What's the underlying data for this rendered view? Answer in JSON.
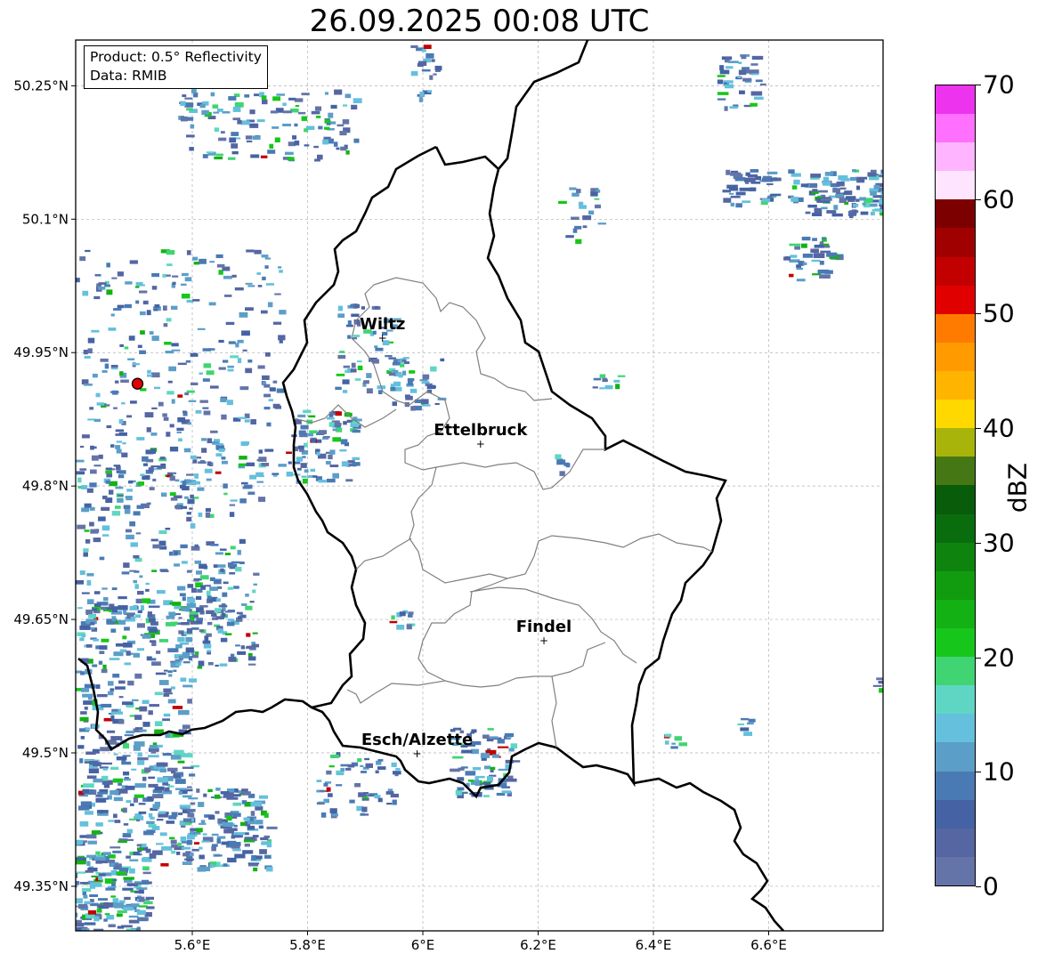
{
  "title": "26.09.2025 00:08 UTC",
  "infobox": {
    "product": "Product: 0.5° Reflectivity",
    "data": "Data: RMIB"
  },
  "lon_ticks": [
    "5.6°E",
    "5.8°E",
    "6°E",
    "6.2°E",
    "6.4°E",
    "6.6°E"
  ],
  "lat_ticks": [
    "50.25°N",
    "50.1°N",
    "49.95°N",
    "49.8°N",
    "49.65°N",
    "49.5°N",
    "49.35°N"
  ],
  "cities": [
    {
      "name": "Wiltz",
      "lon": 5.93,
      "lat": 49.967
    },
    {
      "name": "Ettelbruck",
      "lon": 6.1,
      "lat": 49.848
    },
    {
      "name": "Findel",
      "lon": 6.21,
      "lat": 49.627
    },
    {
      "name": "Esch/Alzette",
      "lon": 5.99,
      "lat": 49.5
    }
  ],
  "radar_site": {
    "lon": 5.505,
    "lat": 49.915,
    "color": "#e00000"
  },
  "colorbar": {
    "label": "dBZ",
    "ticks": [
      "0",
      "10",
      "20",
      "30",
      "40",
      "50",
      "60",
      "70"
    ],
    "colors": [
      "#6474a8",
      "#5566a2",
      "#4563a4",
      "#4a7ab4",
      "#5b9ec8",
      "#64c0dc",
      "#5fd6c4",
      "#40d472",
      "#17c61b",
      "#14b114",
      "#119c0f",
      "#0e840f",
      "#0a6d0d",
      "#085c0a",
      "#457815",
      "#a9b40a",
      "#ffd800",
      "#ffb400",
      "#ff9a00",
      "#ff7b00",
      "#e10000",
      "#c20000",
      "#a10000",
      "#7c0000",
      "#ffe4ff",
      "#ffb4ff",
      "#ff70ff",
      "#ee33ee"
    ]
  }
}
